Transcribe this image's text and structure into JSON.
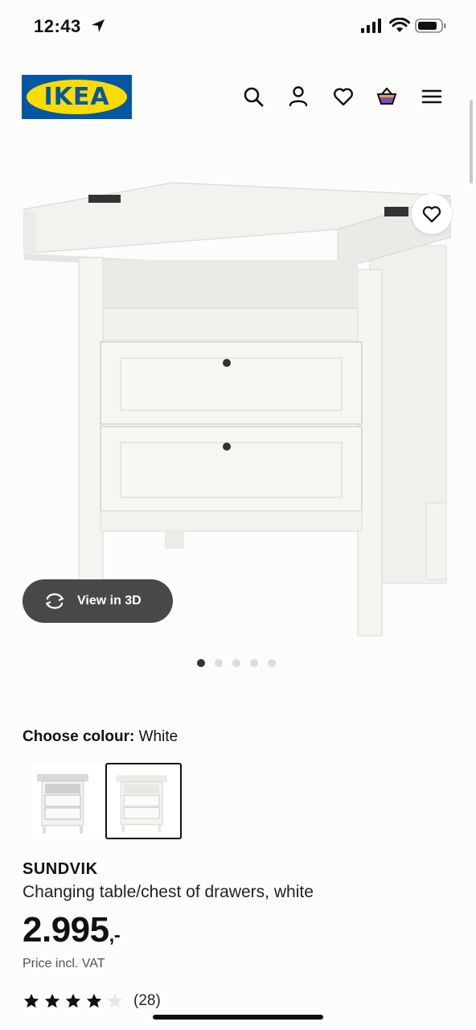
{
  "status_bar": {
    "time": "12:43"
  },
  "header": {
    "logo_text": "IKEA",
    "icons": [
      "search-icon",
      "user-icon",
      "heart-icon",
      "basket-icon",
      "menu-icon"
    ]
  },
  "gallery": {
    "view_3d_label": "View in 3D",
    "image_count": 5,
    "active_index": 0
  },
  "colour": {
    "label": "Choose colour:",
    "selected": "White"
  },
  "product": {
    "name": "SUNDVIK",
    "description": "Changing table/chest of drawers, white",
    "price_main": "2.995",
    "price_suffix": ",-",
    "price_note": "Price incl. VAT",
    "rating": 4,
    "rating_max": 5,
    "review_count": "(28)"
  },
  "colors": {
    "brand_blue": "#0058a3",
    "brand_yellow": "#ffdb00",
    "dark_pill": "#484848"
  }
}
